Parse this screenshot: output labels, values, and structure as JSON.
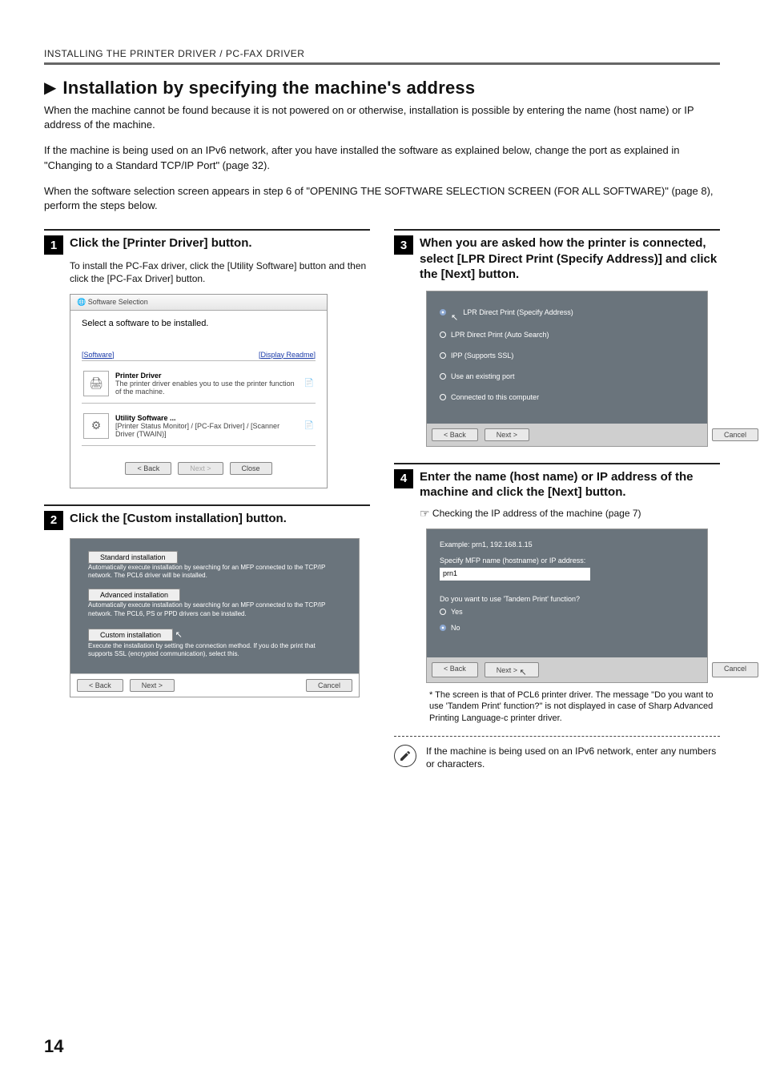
{
  "header": {
    "section": "INSTALLING THE PRINTER DRIVER / PC-FAX DRIVER"
  },
  "title": "Installation by specifying the machine's address",
  "intro": {
    "p1": "When the machine cannot be found because it is not powered on or otherwise, installation is possible by entering the name (host name) or IP address of the machine.",
    "p2a": "If the machine is being used on an IPv6 network, after you have installed the software as explained below, change the port as explained in \"",
    "p2_link": "Changing to a Standard TCP/IP Port",
    "p2b": "\" (page ",
    "p2_page": "32",
    "p2c": ").",
    "p3a": "When the software selection screen appears in step 6 of \"",
    "p3_link": "OPENING THE SOFTWARE SELECTION SCREEN (FOR ALL SOFTWARE)",
    "p3b": "\" (page ",
    "p3_page": "8",
    "p3c": "), perform the steps below."
  },
  "step1": {
    "num": "1",
    "title": "Click the [Printer Driver] button.",
    "sub": "To install the PC-Fax driver, click the [Utility Software] button and then click the [PC-Fax Driver] button.",
    "window_title": "Software Selection",
    "heading": "Select a software to be installed.",
    "label_software": "[Software]",
    "label_readme": "[Display Readme]",
    "item1_title": "Printer Driver",
    "item1_desc": "The printer driver enables you to use the printer function of the machine.",
    "item2_title": "Utility Software ...",
    "item2_desc": "[Printer Status Monitor] / [PC-Fax Driver] / [Scanner Driver (TWAIN)]",
    "btn_back": "< Back",
    "btn_next": "Next >",
    "btn_close": "Close"
  },
  "step2": {
    "num": "2",
    "title": "Click the [Custom installation] button.",
    "opt1_label": "Standard installation",
    "opt1_desc": "Automatically execute installation by searching for an MFP connected to the TCP/IP network. The PCL6 driver will be installed.",
    "opt2_label": "Advanced installation",
    "opt2_desc": "Automatically execute installation by searching for an MFP connected to the TCP/IP network. The PCL6, PS or PPD drivers can be installed.",
    "opt3_label": "Custom installation",
    "opt3_desc": "Execute the installation by setting the connection method. If you do the print that supports SSL (encrypted communication), select this.",
    "btn_back": "< Back",
    "btn_next": "Next >",
    "btn_cancel": "Cancel"
  },
  "step3": {
    "num": "3",
    "title": "When you are asked how the printer is connected, select [LPR Direct Print (Specify Address)] and click the [Next] button.",
    "opt1": "LPR Direct Print (Specify Address)",
    "opt2": "LPR Direct Print (Auto Search)",
    "opt3": "IPP (Supports SSL)",
    "opt4": "Use an existing port",
    "opt5": "Connected to this computer",
    "btn_back": "< Back",
    "btn_next": "Next >",
    "btn_cancel": "Cancel"
  },
  "step4": {
    "num": "4",
    "title": "Enter the name (host name) or IP address of the machine and click the [Next] button.",
    "ref": "Checking the IP address of the machine (page 7)",
    "example": "Example: prn1, 192.168.1.15",
    "field_label": "Specify MFP name (hostname) or IP address:",
    "field_value": "prn1",
    "tandem_q": "Do you want to use 'Tandem Print' function?",
    "yes": "Yes",
    "no": "No",
    "btn_back": "< Back",
    "btn_next": "Next >",
    "btn_cancel": "Cancel",
    "footnote": "* The screen is that of PCL6 printer driver. The message \"Do you want to use 'Tandem Print' function?\" is not displayed in case of Sharp Advanced Printing Language-c printer driver.",
    "note": "If the machine is being used on an IPv6 network, enter any numbers or characters."
  },
  "page_number": "14"
}
